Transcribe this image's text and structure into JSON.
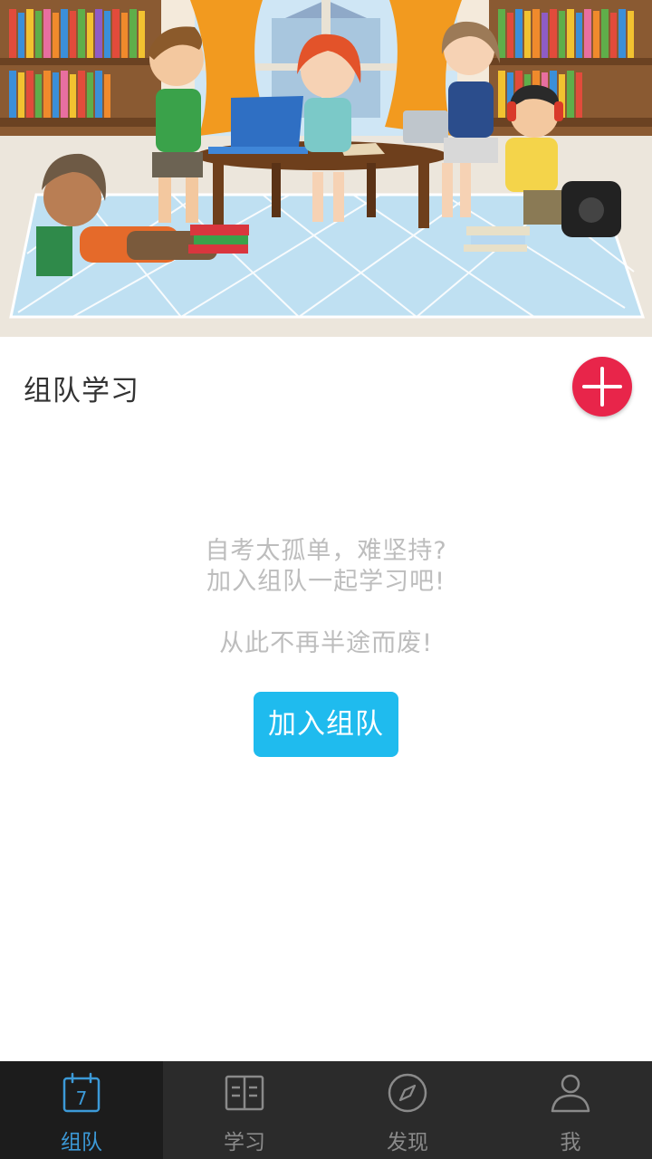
{
  "section": {
    "title": "组队学习",
    "add_icon": "plus-icon"
  },
  "empty_state": {
    "line1": "自考太孤单，难坚持?",
    "line2": "加入组队一起学习吧!",
    "line3": "从此不再半途而废!"
  },
  "join_button": {
    "label": "加入组队"
  },
  "tabs": [
    {
      "label": "组队",
      "icon": "calendar-icon",
      "icon_text": "7",
      "active": true
    },
    {
      "label": "学习",
      "icon": "book-icon",
      "active": false
    },
    {
      "label": "发现",
      "icon": "compass-icon",
      "active": false
    },
    {
      "label": "我",
      "icon": "user-icon",
      "active": false
    }
  ],
  "colors": {
    "accent_red": "#e8254a",
    "accent_blue": "#1fbbee",
    "tab_active": "#3c9ad8",
    "tabbar_bg": "#2b2b2b",
    "hint_text": "#bdbdbd"
  }
}
